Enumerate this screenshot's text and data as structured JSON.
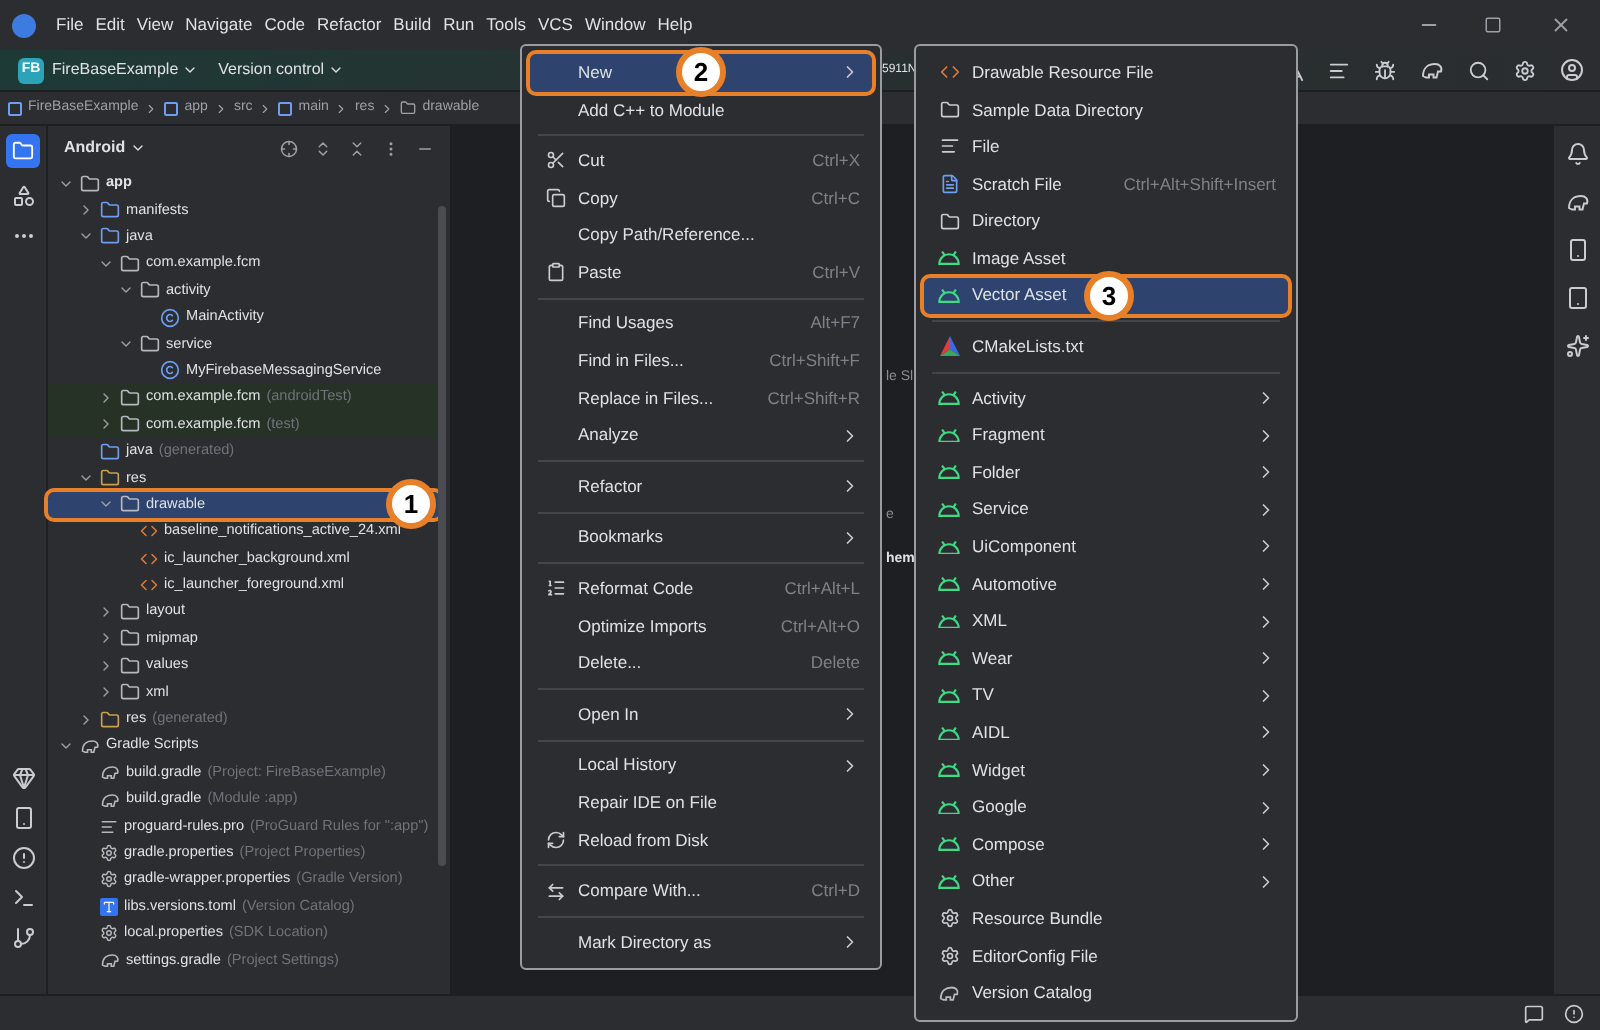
{
  "menu_bar": [
    "File",
    "Edit",
    "View",
    "Navigate",
    "Code",
    "Refactor",
    "Build",
    "Run",
    "Tools",
    "VCS",
    "Window",
    "Help"
  ],
  "toolbar": {
    "project_badge": "FB",
    "project": "FireBaseExample",
    "vcs": "Version control",
    "hidden_fragment": "5911N"
  },
  "breadcrumb": [
    {
      "label": "FireBaseExample",
      "kind": "module"
    },
    {
      "label": "app",
      "kind": "module"
    },
    {
      "label": "src",
      "kind": "plain"
    },
    {
      "label": "main",
      "kind": "module"
    },
    {
      "label": "res",
      "kind": "plain"
    },
    {
      "label": "drawable",
      "kind": "folder"
    }
  ],
  "project_panel": {
    "view": "Android"
  },
  "tree": [
    {
      "label": "app",
      "kind": "module",
      "expanded": true,
      "selected": false,
      "children": [
        {
          "label": "manifests",
          "kind": "folder",
          "expanded": false,
          "selected": false
        },
        {
          "label": "java",
          "kind": "folder",
          "expanded": true,
          "selected": false,
          "children": [
            {
              "label": "com.example.fcm",
              "kind": "package",
              "expanded": true,
              "selected": false,
              "children": [
                {
                  "label": "activity",
                  "kind": "package",
                  "expanded": true,
                  "selected": false,
                  "children": [
                    {
                      "label": "MainActivity",
                      "kind": "class",
                      "selected": false
                    }
                  ]
                },
                {
                  "label": "service",
                  "kind": "package",
                  "expanded": true,
                  "selected": false,
                  "children": [
                    {
                      "label": "MyFirebaseMessagingService",
                      "kind": "class",
                      "selected": false
                    }
                  ]
                }
              ]
            },
            {
              "label": "com.example.fcm",
              "hint": "(androidTest)",
              "kind": "package",
              "tinted": true,
              "expanded": false,
              "selected": false
            },
            {
              "label": "com.example.fcm",
              "hint": "(test)",
              "kind": "package",
              "tinted": true,
              "expanded": false,
              "selected": false
            }
          ]
        },
        {
          "label": "java",
          "hint": "(generated)",
          "kind": "generated",
          "selected": false
        },
        {
          "label": "res",
          "kind": "resfolder",
          "expanded": true,
          "selected": false,
          "children": [
            {
              "label": "drawable",
              "kind": "package",
              "expanded": true,
              "selected": true,
              "callout": "1",
              "children": [
                {
                  "label": "baseline_notifications_active_24.xml",
                  "kind": "xml",
                  "selected": false
                },
                {
                  "label": "ic_launcher_background.xml",
                  "kind": "xml",
                  "selected": false
                },
                {
                  "label": "ic_launcher_foreground.xml",
                  "kind": "xml",
                  "selected": false
                }
              ]
            },
            {
              "label": "layout",
              "kind": "package",
              "expanded": false,
              "selected": false
            },
            {
              "label": "mipmap",
              "kind": "package",
              "expanded": false,
              "selected": false
            },
            {
              "label": "values",
              "kind": "package",
              "expanded": false,
              "selected": false
            },
            {
              "label": "xml",
              "kind": "package",
              "expanded": false,
              "selected": false
            }
          ]
        },
        {
          "label": "res",
          "hint": "(generated)",
          "kind": "resfolder",
          "expanded": false,
          "selected": false
        }
      ]
    },
    {
      "label": "Gradle Scripts",
      "kind": "gradle",
      "expanded": true,
      "selected": false,
      "children": [
        {
          "label": "build.gradle",
          "hint": "(Project: FireBaseExample)",
          "kind": "gradle",
          "selected": false
        },
        {
          "label": "build.gradle",
          "hint": "(Module :app)",
          "kind": "gradle",
          "selected": false
        },
        {
          "label": "proguard-rules.pro",
          "hint": "(ProGuard Rules for \":app\")",
          "kind": "text",
          "selected": false
        },
        {
          "label": "gradle.properties",
          "hint": "(Project Properties)",
          "kind": "settings",
          "selected": false
        },
        {
          "label": "gradle-wrapper.properties",
          "hint": "(Gradle Version)",
          "kind": "settings",
          "selected": false
        },
        {
          "label": "libs.versions.toml",
          "hint": "(Version Catalog)",
          "kind": "toml",
          "selected": false
        },
        {
          "label": "local.properties",
          "hint": "(SDK Location)",
          "kind": "settings",
          "selected": false
        },
        {
          "label": "settings.gradle",
          "hint": "(Project Settings)",
          "kind": "gradle",
          "selected": false
        }
      ]
    }
  ],
  "editor_fragments": [
    {
      "text": "le Sl"
    },
    {
      "text": "e"
    },
    {
      "text": "hem"
    }
  ],
  "context_menu": [
    {
      "kind": "plain",
      "label": "New",
      "submenu": true,
      "selected": true,
      "callout": "2"
    },
    {
      "kind": "plain",
      "label": "Add C++ to Module",
      "submenu": false,
      "selected": false
    },
    {
      "kind": "separator"
    },
    {
      "kind": "cut",
      "label": "Cut",
      "shortcut": "Ctrl+X",
      "submenu": false,
      "selected": false
    },
    {
      "kind": "copy",
      "label": "Copy",
      "shortcut": "Ctrl+C",
      "submenu": false,
      "selected": false
    },
    {
      "kind": "plain",
      "label": "Copy Path/Reference...",
      "submenu": false,
      "selected": false
    },
    {
      "kind": "paste",
      "label": "Paste",
      "shortcut": "Ctrl+V",
      "submenu": false,
      "selected": false
    },
    {
      "kind": "separator"
    },
    {
      "kind": "plain",
      "label": "Find Usages",
      "shortcut": "Alt+F7",
      "submenu": false,
      "selected": false
    },
    {
      "kind": "plain",
      "label": "Find in Files...",
      "shortcut": "Ctrl+Shift+F",
      "submenu": false,
      "selected": false
    },
    {
      "kind": "plain",
      "label": "Replace in Files...",
      "shortcut": "Ctrl+Shift+R",
      "submenu": false,
      "selected": false
    },
    {
      "kind": "plain",
      "label": "Analyze",
      "submenu": true,
      "selected": false
    },
    {
      "kind": "separator"
    },
    {
      "kind": "plain",
      "label": "Refactor",
      "submenu": true,
      "selected": false
    },
    {
      "kind": "separator"
    },
    {
      "kind": "plain",
      "label": "Bookmarks",
      "submenu": true,
      "selected": false
    },
    {
      "kind": "separator"
    },
    {
      "kind": "reformat",
      "label": "Reformat Code",
      "shortcut": "Ctrl+Alt+L",
      "submenu": false,
      "selected": false
    },
    {
      "kind": "plain",
      "label": "Optimize Imports",
      "shortcut": "Ctrl+Alt+O",
      "submenu": false,
      "selected": false
    },
    {
      "kind": "plain",
      "label": "Delete...",
      "shortcut": "Delete",
      "submenu": false,
      "selected": false
    },
    {
      "kind": "separator"
    },
    {
      "kind": "plain",
      "label": "Open In",
      "submenu": true,
      "selected": false
    },
    {
      "kind": "separator"
    },
    {
      "kind": "plain",
      "label": "Local History",
      "submenu": true,
      "selected": false
    },
    {
      "kind": "plain",
      "label": "Repair IDE on File",
      "submenu": false,
      "selected": false
    },
    {
      "kind": "reload",
      "label": "Reload from Disk",
      "submenu": false,
      "selected": false
    },
    {
      "kind": "separator"
    },
    {
      "kind": "compare",
      "label": "Compare With...",
      "shortcut": "Ctrl+D",
      "submenu": false,
      "selected": false
    },
    {
      "kind": "separator"
    },
    {
      "kind": "plain",
      "label": "Mark Directory as",
      "submenu": true,
      "selected": false
    }
  ],
  "new_submenu": [
    {
      "kind": "xml",
      "label": "Drawable Resource File",
      "submenu": false,
      "selected": false
    },
    {
      "kind": "folder",
      "label": "Sample Data Directory",
      "submenu": false,
      "selected": false
    },
    {
      "kind": "file",
      "label": "File",
      "submenu": false,
      "selected": false
    },
    {
      "kind": "scratch",
      "label": "Scratch File",
      "shortcut": "Ctrl+Alt+Shift+Insert",
      "submenu": false,
      "selected": false
    },
    {
      "kind": "folder",
      "label": "Directory",
      "submenu": false,
      "selected": false
    },
    {
      "kind": "android",
      "label": "Image Asset",
      "submenu": false,
      "selected": false
    },
    {
      "kind": "android",
      "label": "Vector Asset",
      "submenu": false,
      "selected": true,
      "callout": "3"
    },
    {
      "kind": "separator"
    },
    {
      "kind": "cmake",
      "label": "CMakeLists.txt",
      "submenu": false,
      "selected": false
    },
    {
      "kind": "separator"
    },
    {
      "kind": "android",
      "label": "Activity",
      "submenu": true,
      "selected": false
    },
    {
      "kind": "android",
      "label": "Fragment",
      "submenu": true,
      "selected": false
    },
    {
      "kind": "android",
      "label": "Folder",
      "submenu": true,
      "selected": false
    },
    {
      "kind": "android",
      "label": "Service",
      "submenu": true,
      "selected": false
    },
    {
      "kind": "android",
      "label": "UiComponent",
      "submenu": true,
      "selected": false
    },
    {
      "kind": "android",
      "label": "Automotive",
      "submenu": true,
      "selected": false
    },
    {
      "kind": "android",
      "label": "XML",
      "submenu": true,
      "selected": false
    },
    {
      "kind": "android",
      "label": "Wear",
      "submenu": true,
      "selected": false
    },
    {
      "kind": "android",
      "label": "TV",
      "submenu": true,
      "selected": false
    },
    {
      "kind": "android",
      "label": "AIDL",
      "submenu": true,
      "selected": false
    },
    {
      "kind": "android",
      "label": "Widget",
      "submenu": true,
      "selected": false
    },
    {
      "kind": "android",
      "label": "Google",
      "submenu": true,
      "selected": false
    },
    {
      "kind": "android",
      "label": "Compose",
      "submenu": true,
      "selected": false
    },
    {
      "kind": "android",
      "label": "Other",
      "submenu": true,
      "selected": false
    },
    {
      "kind": "gear",
      "label": "Resource Bundle",
      "submenu": false,
      "selected": false
    },
    {
      "kind": "gear",
      "label": "EditorConfig File",
      "submenu": false,
      "selected": false
    },
    {
      "kind": "gradle",
      "label": "Version Catalog",
      "submenu": false,
      "selected": false
    }
  ]
}
